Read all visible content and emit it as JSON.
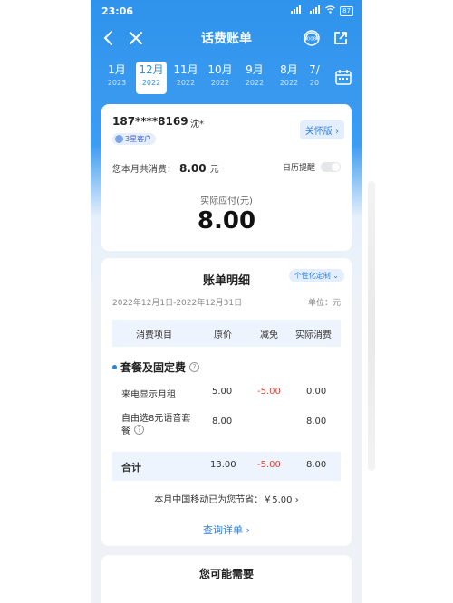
{
  "status": {
    "time": "23:06",
    "signal": "5G",
    "battery": "87"
  },
  "header": {
    "title": "话费账单",
    "service_label": "10086"
  },
  "months": [
    {
      "month": "1月",
      "year": "2023",
      "active": false
    },
    {
      "month": "12月",
      "year": "2022",
      "active": true
    },
    {
      "month": "11月",
      "year": "2022",
      "active": false
    },
    {
      "month": "10月",
      "year": "2022",
      "active": false
    },
    {
      "month": "9月",
      "year": "2022",
      "active": false
    },
    {
      "month": "8月",
      "year": "2022",
      "active": false
    },
    {
      "month": "7/",
      "year": "20",
      "active": false
    }
  ],
  "account": {
    "phone": "187****8169",
    "name": "沈*",
    "star": "3星客户",
    "care_label": "关怀版",
    "total_label": "您本月共消费：",
    "total_value": "8.00",
    "total_unit": "元",
    "calendar_label": "日历提醒",
    "calendar_on": false,
    "actual_label": "实际应付(元)",
    "actual_amount": "8.00"
  },
  "bill": {
    "title": "账单明细",
    "custom_label": "个性化定制",
    "period": "2022年12月1日-2022年12月31日",
    "unit": "单位：元",
    "headers": [
      "消费项目",
      "原价",
      "减免",
      "实际消费"
    ],
    "section": "套餐及固定费",
    "rows": [
      {
        "item": "来电显示月租",
        "price": "5.00",
        "discount": "-5.00",
        "actual": "0.00"
      },
      {
        "item_line1": "自由选8元语音套",
        "item_line2": "餐",
        "price": "8.00",
        "discount": "",
        "actual": "8.00"
      }
    ],
    "total": {
      "label": "合计",
      "price": "13.00",
      "discount": "-5.00",
      "actual": "8.00"
    },
    "savings": "本月中国移动已为您节省：￥5.00",
    "detail_link": "查询详单"
  },
  "recommend": {
    "title": "您可能需要"
  }
}
